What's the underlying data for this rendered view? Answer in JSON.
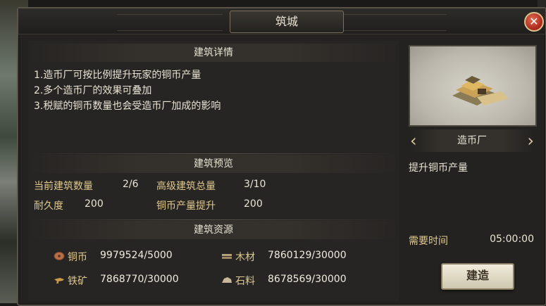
{
  "window": {
    "title": "筑城",
    "close_label": "✕"
  },
  "details": {
    "header": "建筑详情",
    "lines": [
      "1.造币厂可按比例提升玩家的铜币产量",
      "2.多个造币厂的效果可叠加",
      "3.税赋的铜币数量也会受造币厂加成的影响"
    ]
  },
  "preview": {
    "header": "建筑预览",
    "current_count_label": "当前建筑数量",
    "current_count_value": "2/6",
    "advanced_total_label": "高级建筑总量",
    "advanced_total_value": "3/10",
    "durability_label": "耐久度",
    "durability_value": "200",
    "copper_boost_label": "铜币产量提升",
    "copper_boost_value": "200"
  },
  "resources": {
    "header": "建筑资源",
    "items": [
      {
        "label": "铜币",
        "value": "9979524/5000",
        "icon": "copper-coin-icon",
        "color": "#b5704a"
      },
      {
        "label": "木材",
        "value": "7860129/30000",
        "icon": "wood-icon",
        "color": "#b8a27a"
      },
      {
        "label": "铁矿",
        "value": "7868770/30000",
        "icon": "iron-ore-icon",
        "color": "#c79a4c"
      },
      {
        "label": "石料",
        "value": "8678569/30000",
        "icon": "stone-icon",
        "color": "#c8b89a"
      }
    ]
  },
  "building": {
    "name": "造币厂",
    "prev_label": "‹",
    "next_label": "›",
    "description": "提升铜币产量",
    "time_label": "需要时间",
    "time_value": "05:00:00",
    "build_label": "建造"
  }
}
